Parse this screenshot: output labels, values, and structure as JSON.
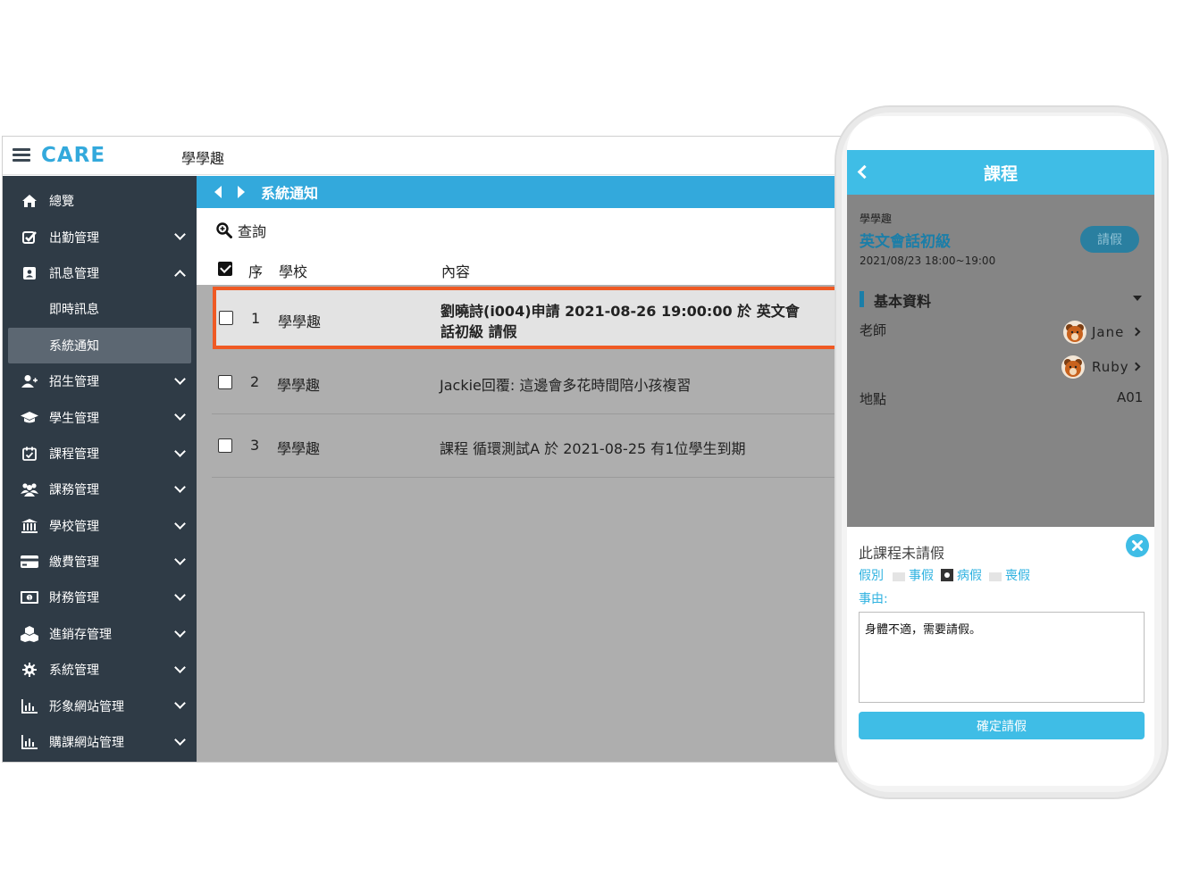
{
  "app": {
    "logo": "CARE",
    "org": "學學趣"
  },
  "sidebar": {
    "items": [
      {
        "label": "總覽",
        "icon": "home-icon",
        "chevron": "none"
      },
      {
        "label": "出勤管理",
        "icon": "check-square-icon",
        "chevron": "down"
      },
      {
        "label": "訊息管理",
        "icon": "contact-card-icon",
        "chevron": "up"
      },
      {
        "label": "即時訊息",
        "sub": true
      },
      {
        "label": "系統通知",
        "sub": true,
        "active": true
      },
      {
        "label": "招生管理",
        "icon": "user-plus-icon",
        "chevron": "down"
      },
      {
        "label": "學生管理",
        "icon": "graduation-cap-icon",
        "chevron": "down"
      },
      {
        "label": "課程管理",
        "icon": "calendar-check-icon",
        "chevron": "down"
      },
      {
        "label": "課務管理",
        "icon": "users-icon",
        "chevron": "down"
      },
      {
        "label": "學校管理",
        "icon": "bank-icon",
        "chevron": "down"
      },
      {
        "label": "繳費管理",
        "icon": "credit-card-icon",
        "chevron": "down"
      },
      {
        "label": "財務管理",
        "icon": "money-icon",
        "chevron": "down"
      },
      {
        "label": "進銷存管理",
        "icon": "cubes-icon",
        "chevron": "down"
      },
      {
        "label": "系統管理",
        "icon": "gear-icon",
        "chevron": "down"
      },
      {
        "label": "形象網站管理",
        "icon": "bar-chart-icon",
        "chevron": "down"
      },
      {
        "label": "購課網站管理",
        "icon": "bar-chart-icon",
        "chevron": "down"
      }
    ]
  },
  "main": {
    "header_title": "系統通知",
    "query_label": "查詢",
    "columns": {
      "seq": "序",
      "school": "學校",
      "content": "內容"
    },
    "rows": [
      {
        "seq": "1",
        "school": "學學趣",
        "content_line1": "劉曉詩(i004)申請 2021-08-26 19:00:00 於 英文會",
        "content_line2": "話初級 請假"
      },
      {
        "seq": "2",
        "school": "學學趣",
        "content_line1": "Jackie回覆: 這邊會多花時間陪小孩複習",
        "content_line2": ""
      },
      {
        "seq": "3",
        "school": "學學趣",
        "content_line1": "課程 循環測試A 於 2021-08-25 有1位學生到期",
        "content_line2": ""
      }
    ]
  },
  "phone": {
    "title": "課程",
    "org": "學學趣",
    "course_name": "英文會話初級",
    "leave_button": "請假",
    "datetime": "2021/08/23  18:00~19:00",
    "section_title": "基本資料",
    "teacher_label": "老師",
    "teachers": [
      "Jane",
      "Ruby"
    ],
    "location_label": "地點",
    "location_value": "A01",
    "sheet_title": "此課程未請假",
    "leave_type_label": "假別",
    "leave_types": [
      {
        "label": "事假",
        "selected": false
      },
      {
        "label": "病假",
        "selected": true
      },
      {
        "label": "喪假",
        "selected": false
      }
    ],
    "reason_label": "事由:",
    "reason_value": "身體不適，需要請假。",
    "confirm_button": "確定請假"
  },
  "colors": {
    "accent": "#33a9dc",
    "sidebar": "#2f3b46",
    "highlight": "#ef5a24",
    "phone_accent": "#3fbde6"
  }
}
